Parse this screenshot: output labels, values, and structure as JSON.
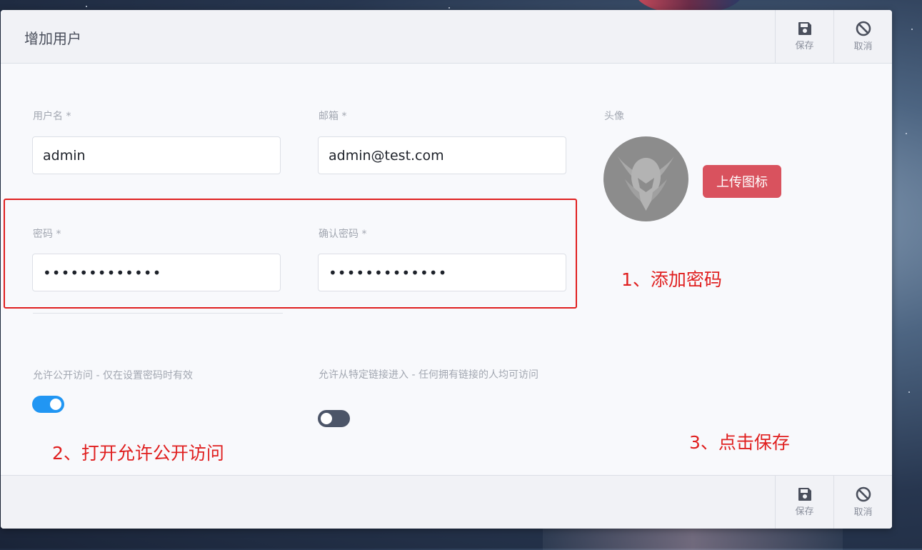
{
  "dialog": {
    "title": "增加用户",
    "actions": {
      "save_label": "保存",
      "cancel_label": "取消"
    }
  },
  "form": {
    "username": {
      "label": "用户名 *",
      "value": "admin"
    },
    "email": {
      "label": "邮箱 *",
      "value": "admin@test.com"
    },
    "password": {
      "label": "密码 *",
      "value": "•••••••••••••"
    },
    "confirm_password": {
      "label": "确认密码 *",
      "value": "•••••••••••••"
    },
    "avatar": {
      "label": "头像",
      "upload_label": "上传图标"
    },
    "public_access": {
      "label": "允许公开访问 - 仅在设置密码时有效",
      "enabled": true
    },
    "link_access": {
      "label": "允许从特定链接进入 - 任何拥有链接的人均可访问",
      "enabled": false
    }
  },
  "annotations": {
    "step1": "1、添加密码",
    "step2": "2、打开允许公开访问",
    "step3": "3、点击保存"
  },
  "colors": {
    "annotation": "#e02020",
    "upload_button": "#d9525e",
    "toggle_on": "#2196f3",
    "toggle_off": "#4c5568"
  },
  "icons": {
    "save": "floppy-disk",
    "cancel": "prohibited-circle"
  }
}
